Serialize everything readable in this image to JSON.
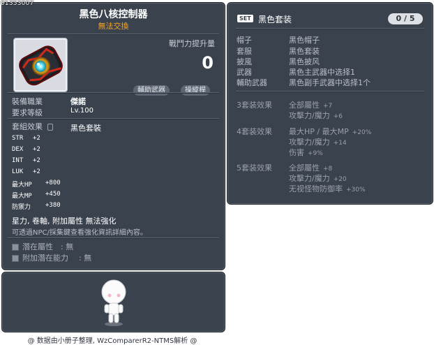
{
  "item_id": "01353007",
  "item": {
    "name": "黑色八核控制器",
    "tradable": "無法交換",
    "power_label": "戰鬥力提升量",
    "power_value": "0",
    "tags": [
      "輔助武器",
      "操縱桿"
    ],
    "job_label": "裝備職業",
    "job_value": "傑諾",
    "level_label": "要求等級",
    "level_value": "Lv.100",
    "set_label": "套組效果",
    "set_value": "黑色套裝",
    "stats": [
      {
        "name": "STR",
        "value": "+2"
      },
      {
        "name": "DEX",
        "value": "+2"
      },
      {
        "name": "INT",
        "value": "+2"
      },
      {
        "name": "LUK",
        "value": "+2"
      },
      {
        "name": "最大HP",
        "value": "+800"
      },
      {
        "name": "最大MP",
        "value": "+450"
      },
      {
        "name": "防禦力",
        "value": "+380"
      }
    ],
    "notes": "星力, 卷軸, 附加屬性 無法強化",
    "hint": "可透過NPC/採集鍵查看強化資訊詳細內容。",
    "potential_label": "潛在屬性",
    "potential_value": ": 無",
    "bonus_potential_label": "附加潛在能力",
    "bonus_potential_value": ": 無"
  },
  "set": {
    "badge": "SET",
    "name": "黑色套装",
    "count": "0 / 5",
    "pieces": [
      {
        "slot": "帽子",
        "item": "黑色帽子"
      },
      {
        "slot": "套服",
        "item": "黑色套装"
      },
      {
        "slot": "披風",
        "item": "黑色披风"
      },
      {
        "slot": "武器",
        "item": "黑色主武器中选择1"
      },
      {
        "slot": "輔助武器",
        "item": "黑色副手武器中选择1个"
      }
    ],
    "effects": [
      {
        "label": "3套装效果",
        "lines": [
          {
            "text": "全部屬性",
            "value": "+7"
          },
          {
            "text": "攻擊力/魔力",
            "value": "+6"
          }
        ]
      },
      {
        "label": "4套装效果",
        "lines": [
          {
            "text": "最大HP / 最大MP",
            "value": "+20%"
          },
          {
            "text": "攻擊力/魔力",
            "value": "+14"
          },
          {
            "text": "伤害",
            "value": "+9%"
          }
        ]
      },
      {
        "label": "5套装效果",
        "lines": [
          {
            "text": "全部屬性",
            "value": "+8"
          },
          {
            "text": "攻擊力/魔力",
            "value": "+20"
          },
          {
            "text": "无视怪物防御率",
            "value": "+30%"
          }
        ]
      }
    ]
  },
  "footer": "@ 数据由小册子整理, WzComparerR2-NTMS解析 @",
  "icons": [
    "item-icon",
    "lock-icon",
    "avatar-icon"
  ],
  "colors": {
    "panel": "#3a424e",
    "tradable": "#f5a524"
  }
}
